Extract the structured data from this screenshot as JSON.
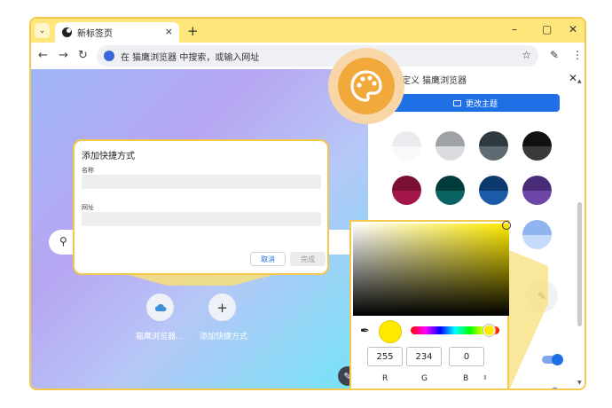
{
  "tab": {
    "title": "新标签页",
    "close": "×"
  },
  "window": {
    "new_tab": "+",
    "minimize": "–",
    "maximize": "▢",
    "close": "✕"
  },
  "nav": {
    "back": "←",
    "forward": "→",
    "reload": "↻"
  },
  "omnibox": {
    "text": "在 猫鹰浏览器 中搜索，或输入网址",
    "star": "☆"
  },
  "toolbar": {
    "edit": "✎",
    "menu": "⋮"
  },
  "side_panel": {
    "title": "定义 猫鹰浏览器",
    "close": "✕",
    "change_theme": "更改主题",
    "swatches": [
      {
        "top": "#e9ebee",
        "bottom": "#f8f9fa"
      },
      {
        "top": "#9ea1a6",
        "bottom": "#dadce0"
      },
      {
        "top": "#2f3a40",
        "bottom": "#5f6b72"
      },
      {
        "top": "#111111",
        "bottom": "#3a3a3a"
      },
      {
        "top": "#7a0f33",
        "bottom": "#a3164a"
      },
      {
        "top": "#003c3c",
        "bottom": "#0b6262"
      },
      {
        "top": "#0d3a6e",
        "bottom": "#1a5ba8"
      },
      {
        "top": "#4a2b78",
        "bottom": "#6e46a8"
      },
      {
        "top": "#f4a6b1",
        "bottom": "#fbd3d9"
      },
      {
        "top": "#8ad08d",
        "bottom": "#bde8bf"
      },
      {
        "top": "#54c8c2",
        "bottom": "#9de2dd"
      },
      {
        "top": "#8fb4ef",
        "bottom": "#c6dafb"
      }
    ],
    "custom_pencil": "✎"
  },
  "ntp": {
    "shortcuts": [
      {
        "label": "猫鹰浏览器...",
        "icon": "cloud-icon"
      },
      {
        "label": "添加快捷方式",
        "icon": "plus-icon",
        "glyph": "+"
      }
    ],
    "search_icon": "⚲",
    "edit_icon": "✎"
  },
  "dialog": {
    "title": "添加快捷方式",
    "name_label": "名称",
    "url_label": "网址",
    "cancel": "取消",
    "done": "完成"
  },
  "color_picker": {
    "dropper": "✒",
    "r": "255",
    "g": "234",
    "b": "0",
    "r_label": "R",
    "g_label": "G",
    "b_label": "B",
    "swap": "⇕",
    "current_color": "#ffea00"
  },
  "colors": {
    "accent": "#1f6fe6",
    "highlight": "#f2c94c",
    "tab_bar": "#ffe67a"
  }
}
